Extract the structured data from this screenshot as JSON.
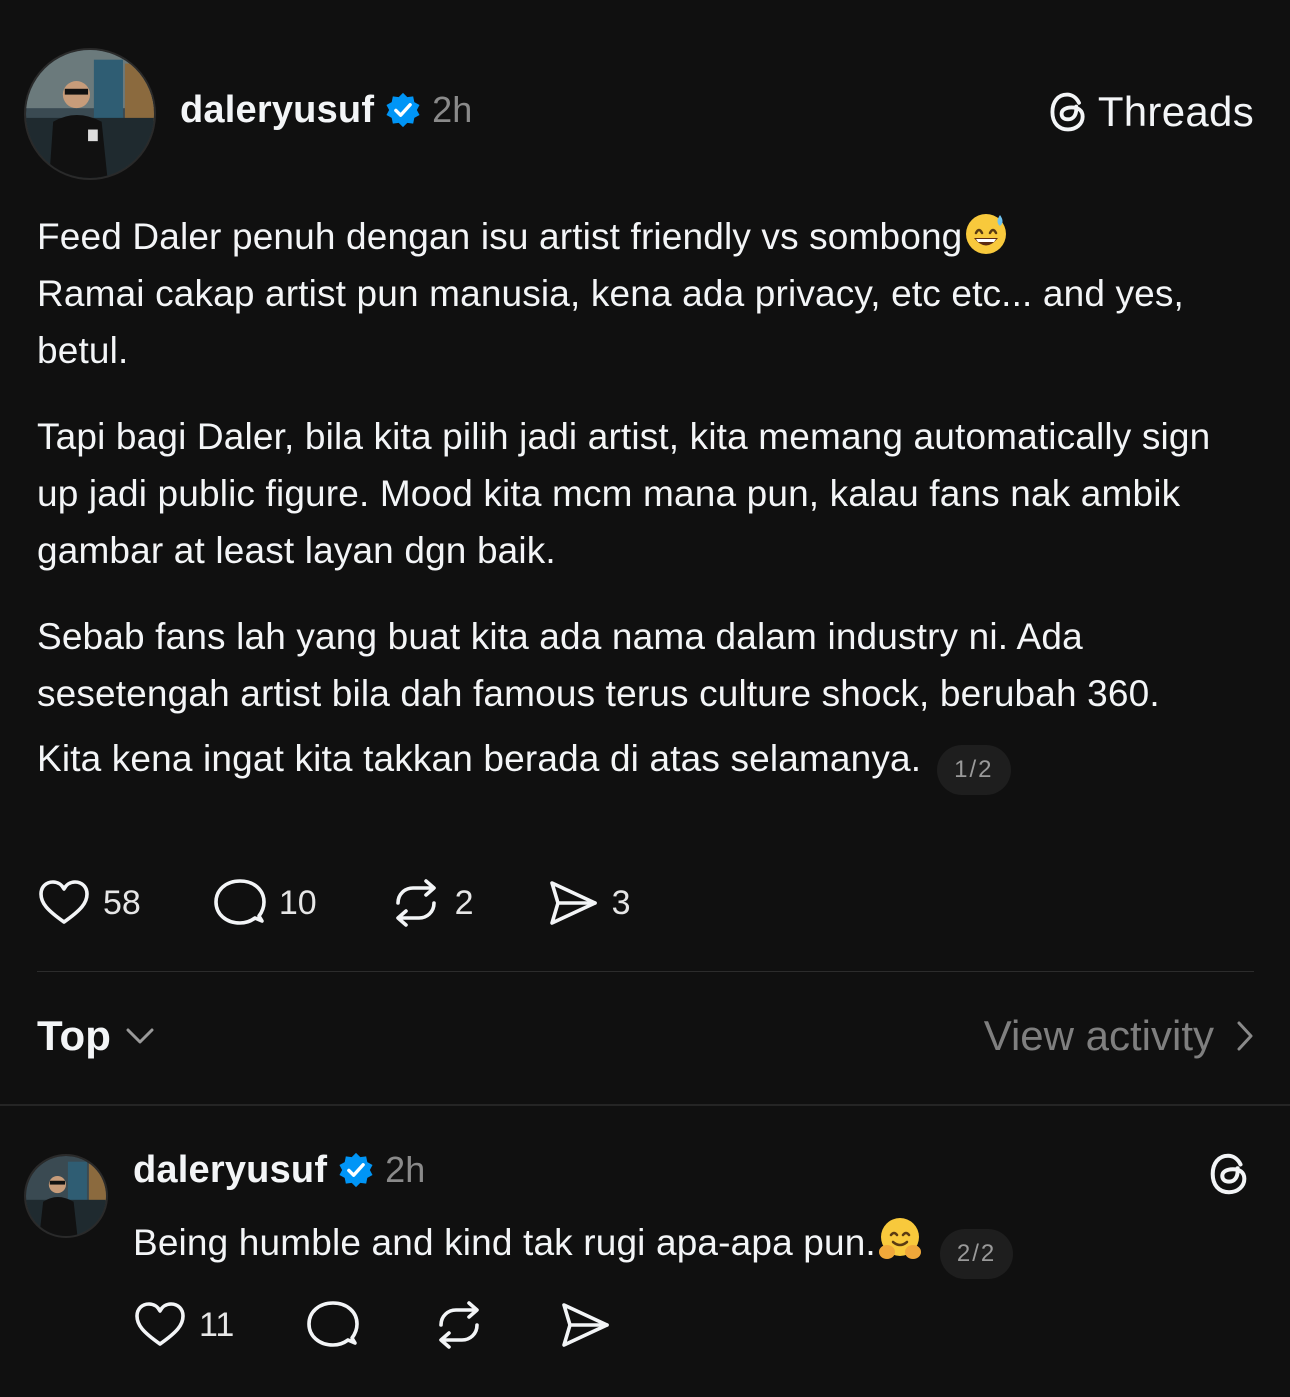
{
  "post": {
    "username": "daleryusuf",
    "verified": true,
    "time": "2h",
    "brand": "Threads",
    "line1": "Feed Daler penuh dengan isu artist friendly vs sombong",
    "line2": "Ramai cakap artist pun manusia, kena ada privacy, etc etc... and yes, betul.",
    "para2": "Tapi bagi Daler, bila kita pilih jadi artist, kita memang automatically sign up jadi public figure. Mood kita mcm mana pun, kalau fans nak ambik gambar at least layan dgn baik.",
    "para3": "Sebab fans lah yang buat kita ada nama dalam industry ni. Ada sesetengah artist bila dah famous terus culture shock, berubah 360.",
    "para4": "Kita kena ingat kita takkan berada di atas selamanya.",
    "page_badge": "1/2",
    "likes": "58",
    "replies": "10",
    "reposts": "2",
    "shares": "3"
  },
  "sort": {
    "label": "Top",
    "view_activity": "View activity"
  },
  "reply": {
    "username": "daleryusuf",
    "verified": true,
    "time": "2h",
    "text": "Being humble and kind tak rugi apa-apa pun.",
    "page_badge": "2/2",
    "likes": "11"
  },
  "colors": {
    "background": "#101010",
    "text": "#f3f5f7",
    "muted": "#8a8a8a",
    "verified_blue": "#0095f6"
  },
  "icons": [
    "verified-badge-icon",
    "threads-logo-icon",
    "heart-icon",
    "comment-icon",
    "repost-icon",
    "share-icon",
    "chevron-down-icon",
    "chevron-right-icon",
    "grinning-sweat-emoji-icon",
    "hugging-face-emoji-icon"
  ]
}
